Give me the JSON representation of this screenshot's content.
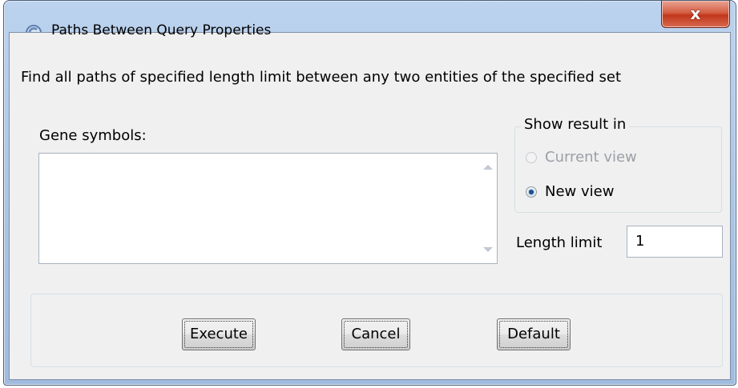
{
  "window": {
    "title": "Paths Between Query Properties",
    "close_label": "x"
  },
  "description": "Find all paths of specified length limit between any two entities of the specified set",
  "gene_symbols": {
    "label": "Gene symbols:",
    "value": ""
  },
  "show_result": {
    "legend": "Show result in",
    "options": [
      {
        "label": "Current view",
        "enabled": false,
        "checked": false
      },
      {
        "label": "New view",
        "enabled": true,
        "checked": true
      }
    ]
  },
  "length_limit": {
    "label": "Length limit",
    "value": "1"
  },
  "buttons": {
    "execute": "Execute",
    "cancel": "Cancel",
    "default": "Default"
  },
  "colors": {
    "accent": "#1d4f91",
    "close": "#c1371c",
    "frame": "#a9c3e3"
  }
}
